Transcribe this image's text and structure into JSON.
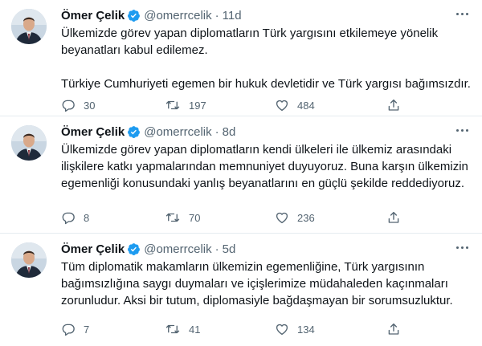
{
  "colors": {
    "text": "#0f1419",
    "secondary": "#536471",
    "verified_badge": "#1d9bf0",
    "divider": "#e6ecf0"
  },
  "tweets": [
    {
      "name": "Ömer Çelik",
      "handle": "@omerrcelik",
      "separator": "·",
      "time": "11d",
      "paragraphs": [
        "Ülkemizde görev yapan diplomatların Türk yargısını etkilemeye yönelik beyanatları kabul edilemez.",
        "Türkiye Cumhuriyeti egemen bir hukuk devletidir ve Türk yargısı bağımsızdır."
      ],
      "replies": "30",
      "retweets": "197",
      "likes": "484"
    },
    {
      "name": "Ömer Çelik",
      "handle": "@omerrcelik",
      "separator": "·",
      "time": "8d",
      "paragraphs": [
        "Ülkemizde görev yapan diplomatların kendi ülkeleri ile ülkemiz arasındaki ilişkilere katkı yapmalarından memnuniyet duyuyoruz. Buna karşın ülkemizin egemenliği konusundaki yanlış beyanatlarını en güçlü şekilde reddediyoruz."
      ],
      "replies": "8",
      "retweets": "70",
      "likes": "236"
    },
    {
      "name": "Ömer Çelik",
      "handle": "@omerrcelik",
      "separator": "·",
      "time": "5d",
      "paragraphs": [
        "Tüm diplomatik makamların ülkemizin egemenliğine, Türk yargısının bağımsızlığına saygı duymaları ve içişlerimize müdahaleden kaçınmaları zorunludur. Aksi bir tutum, diplomasiyle bağdaşmayan bir sorumsuzluktur."
      ],
      "replies": "7",
      "retweets": "41",
      "likes": "134"
    }
  ],
  "icons": {
    "verified": "verified-badge-icon",
    "more": "more-options-icon",
    "reply": "reply-icon",
    "retweet": "retweet-icon",
    "like": "heart-icon",
    "share": "share-icon"
  }
}
